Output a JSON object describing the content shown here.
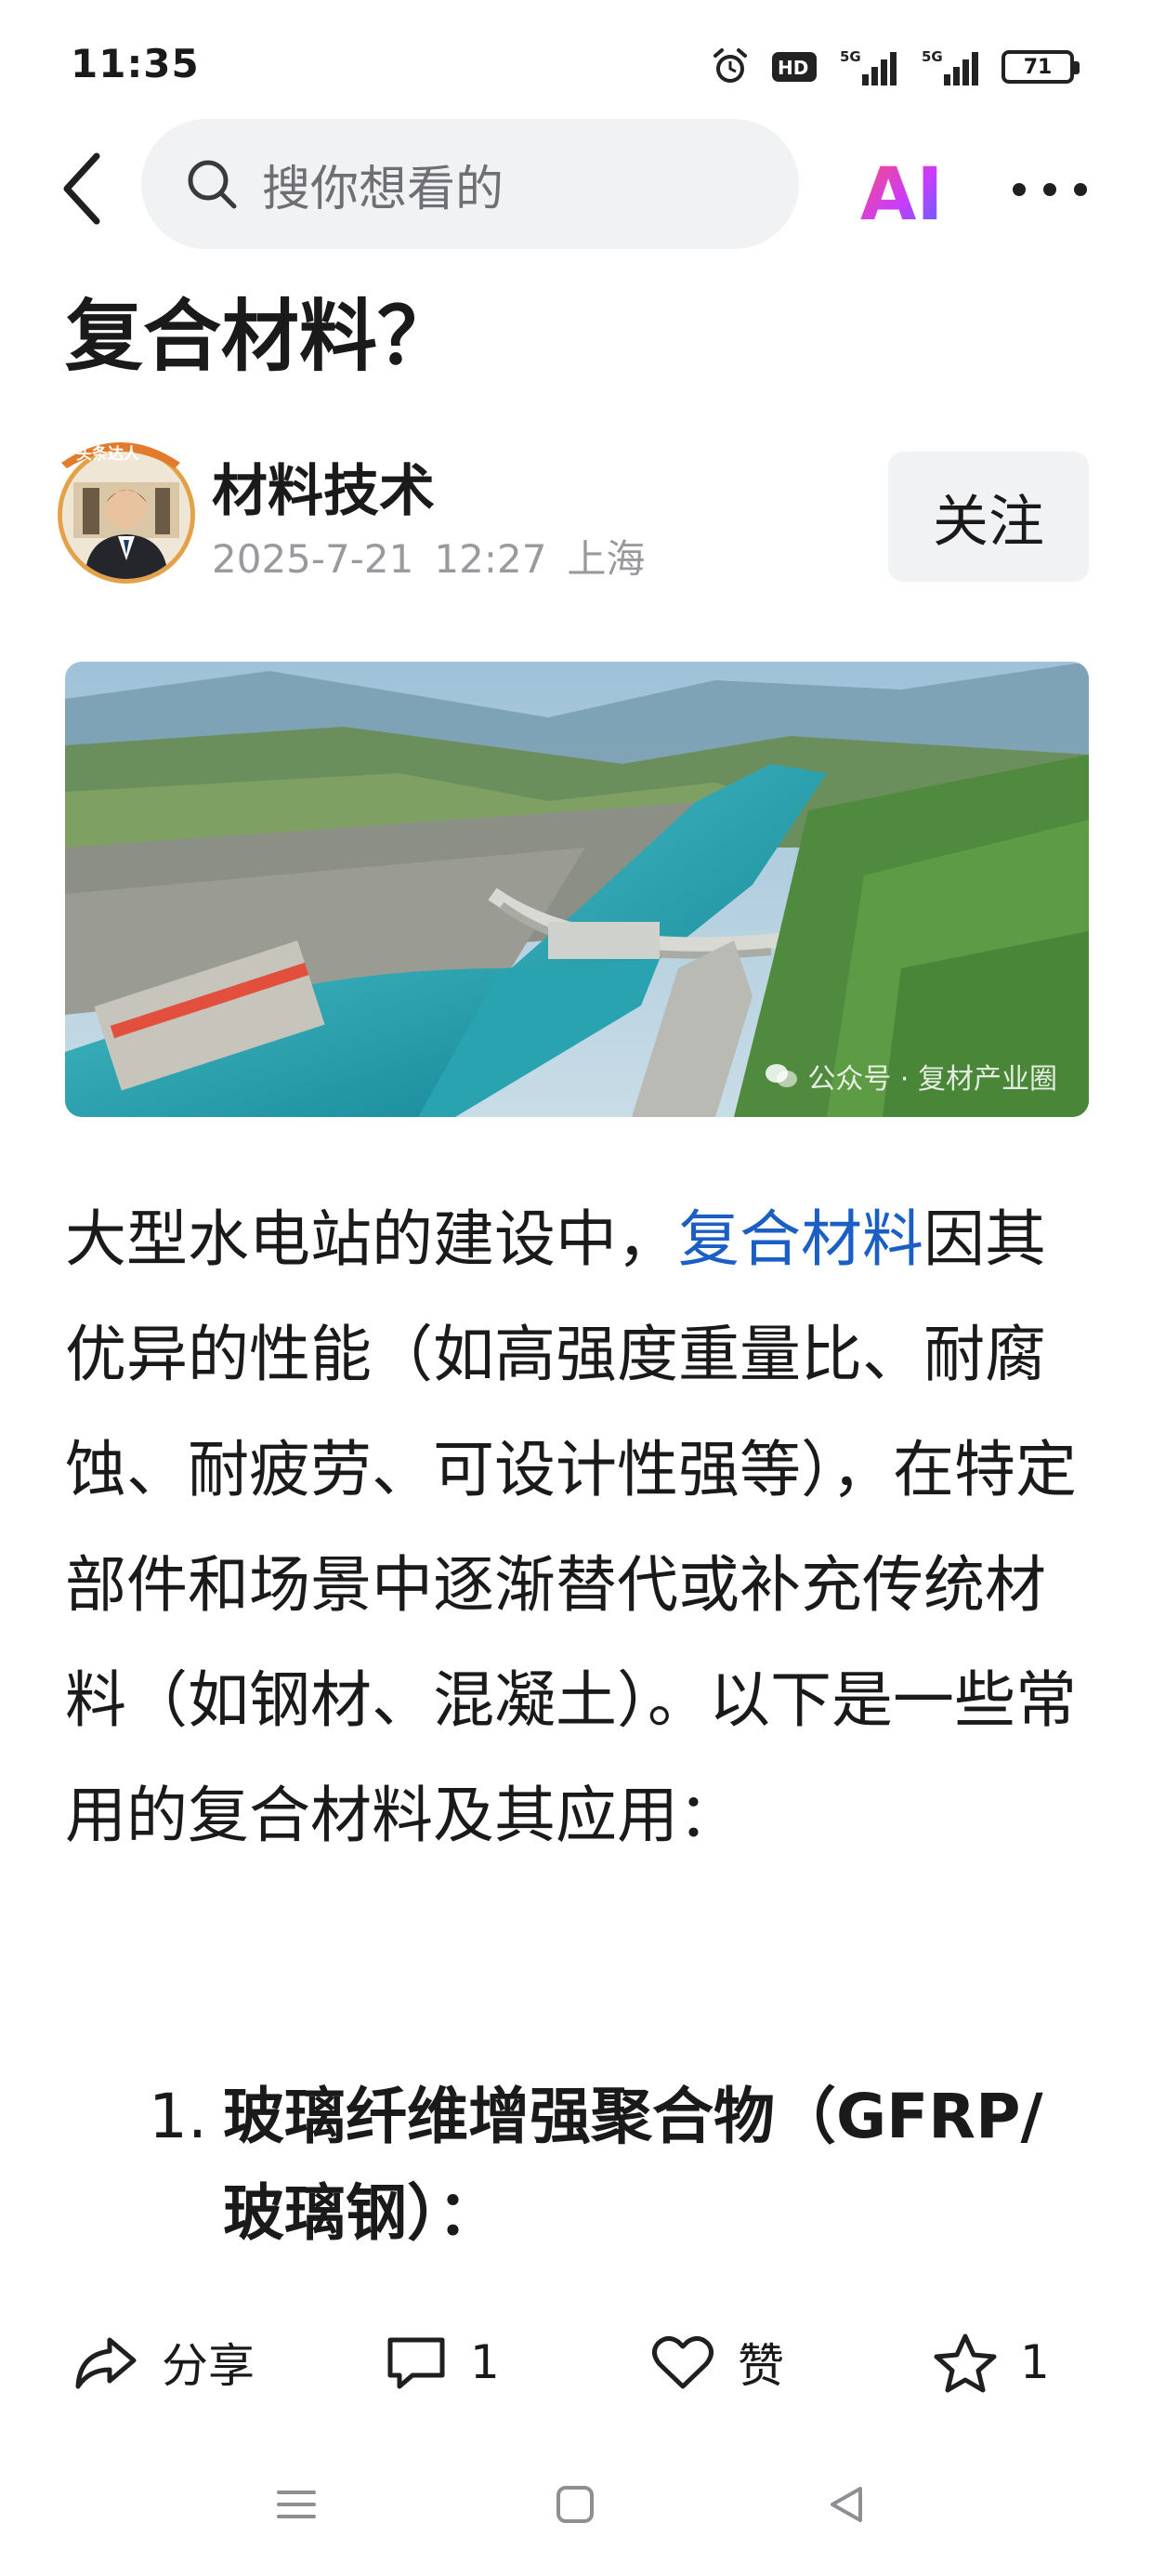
{
  "status_bar": {
    "time": "11:35",
    "network_a": "5G",
    "network_b": "5G",
    "hd_label": "HD",
    "battery": "71"
  },
  "search": {
    "placeholder": "搜你想看的"
  },
  "ai_button": {
    "label": "AI"
  },
  "article": {
    "title": "复合材料？",
    "author": "材料技术",
    "badge_text": "头条达人",
    "date": "2025-7-21",
    "time": "12:27",
    "location": "上海",
    "follow_label": "关注",
    "image_watermark": "公众号 · 复材产业圈",
    "body_before_link": "大型水电站的建设中，",
    "body_link": "复合材料",
    "body_after_link": "因其优异的性能（如高强度重量比、耐腐蚀、耐疲劳、可设计性强等），在特定部件和场景中逐渐替代或补充传统材料（如钢材、混凝土）。以下是一些常用的复合材料及其应用：",
    "list": [
      {
        "num": "1.",
        "text": "玻璃纤维增强聚合物（GFRP/玻璃钢）："
      }
    ]
  },
  "actions": {
    "share": "分享",
    "comments": "1",
    "like": "赞",
    "favorites": "1"
  },
  "colors": {
    "link": "#1b5fc4",
    "ai_gradient_start": "#ff4d6d",
    "ai_gradient_end": "#4a6cff",
    "meta_gray": "#9a9a9e"
  }
}
